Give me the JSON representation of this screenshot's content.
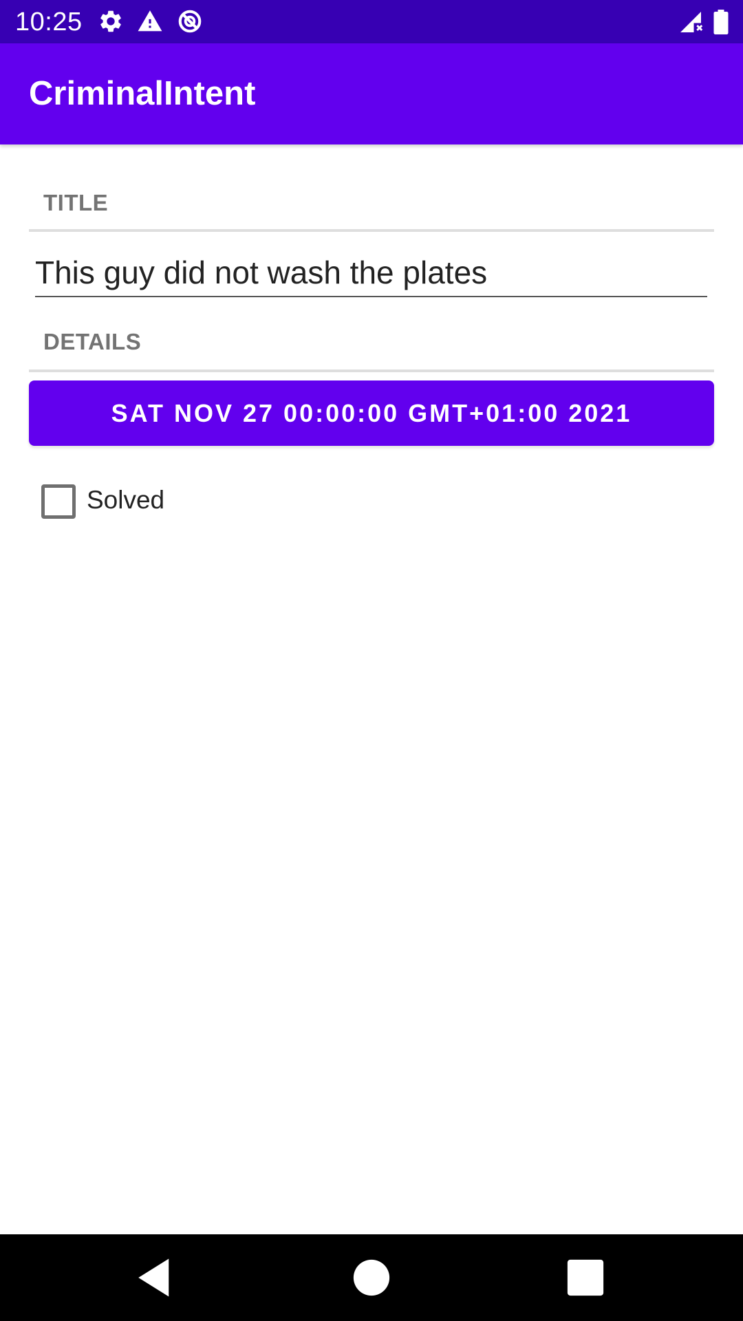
{
  "status_bar": {
    "time": "10:25",
    "icons": [
      "gear-icon",
      "alert-icon",
      "no-data-icon",
      "signal-icon",
      "battery-icon"
    ],
    "background": "#3700B3"
  },
  "app_bar": {
    "title": "CriminalIntent",
    "background": "#6200EE"
  },
  "form": {
    "title_header": "TITLE",
    "title_value": "This guy did not wash the plates",
    "details_header": "DETAILS",
    "date_label": "SAT NOV 27 00:00:00 GMT+01:00 2021",
    "solved_label": "Solved",
    "solved_checked": false
  },
  "nav_bar": {
    "icons": [
      "back-icon",
      "home-icon",
      "recents-icon"
    ]
  }
}
